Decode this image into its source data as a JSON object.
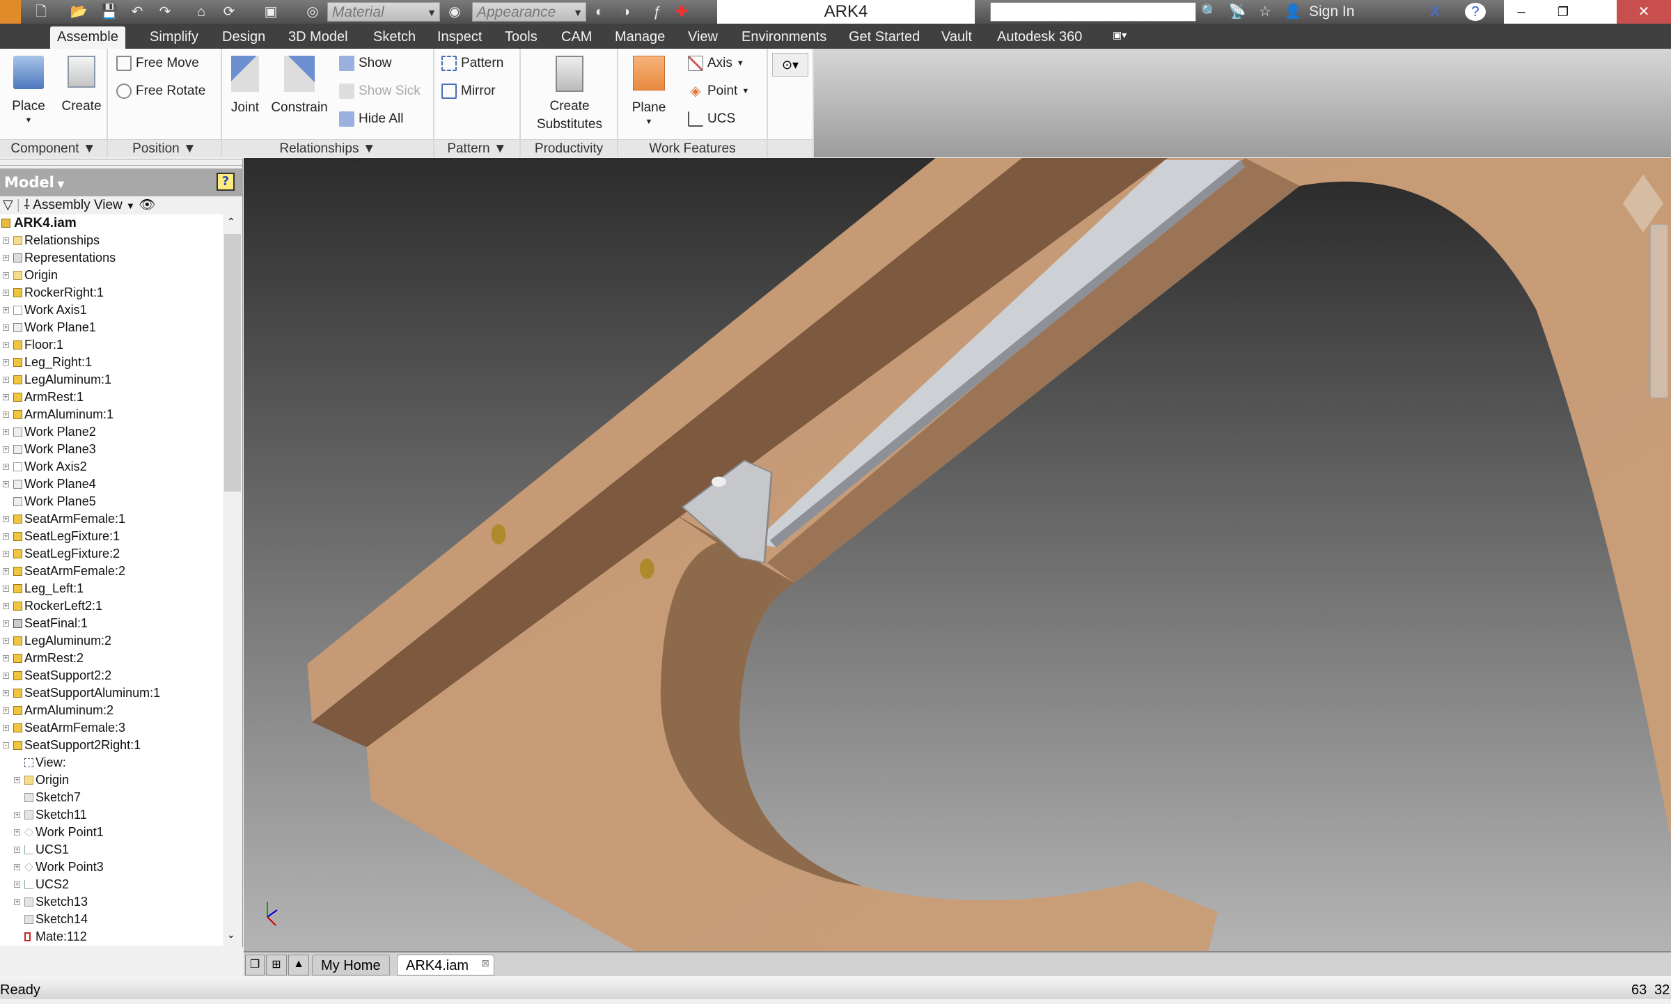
{
  "app": {
    "title": "ARK4",
    "sign_in": "Sign In"
  },
  "quick_access": {
    "material": "Material",
    "appearance": "Appearance",
    "search_value": ""
  },
  "tabs": [
    "Assemble",
    "Simplify",
    "Design",
    "3D Model",
    "Sketch",
    "Inspect",
    "Tools",
    "CAM",
    "Manage",
    "View",
    "Environments",
    "Get Started",
    "Vault",
    "Autodesk 360"
  ],
  "active_tab": "Assemble",
  "ribbon": {
    "component": {
      "label": "Component",
      "place": "Place",
      "create": "Create"
    },
    "position": {
      "label": "Position",
      "free_move": "Free Move",
      "free_rotate": "Free Rotate"
    },
    "relationships": {
      "label": "Relationships",
      "joint": "Joint",
      "constrain": "Constrain",
      "show": "Show",
      "show_sick": "Show Sick",
      "hide_all": "Hide All"
    },
    "pattern": {
      "label": "Pattern",
      "pattern": "Pattern",
      "mirror": "Mirror"
    },
    "productivity": {
      "label": "Productivity",
      "create_substitutes_1": "Create",
      "create_substitutes_2": "Substitutes"
    },
    "work_features": {
      "label": "Work Features",
      "plane": "Plane",
      "axis": "Axis",
      "point": "Point",
      "ucs": "UCS"
    }
  },
  "browser": {
    "title": "Model",
    "view": "Assembly View",
    "root": "ARK4.iam",
    "items": [
      {
        "label": "Relationships",
        "level": 0,
        "exp": "+",
        "icon": "folder"
      },
      {
        "label": "Representations",
        "level": 0,
        "exp": "+",
        "icon": "representations"
      },
      {
        "label": "Origin",
        "level": 0,
        "exp": "+",
        "icon": "folder"
      },
      {
        "label": "RockerRight:1",
        "level": 0,
        "exp": "+",
        "icon": "part"
      },
      {
        "label": "Work Axis1",
        "level": 0,
        "exp": "+",
        "icon": "work-axis"
      },
      {
        "label": "Work Plane1",
        "level": 0,
        "exp": "+",
        "icon": "work-plane"
      },
      {
        "label": "Floor:1",
        "level": 0,
        "exp": "+",
        "icon": "part"
      },
      {
        "label": "Leg_Right:1",
        "level": 0,
        "exp": "+",
        "icon": "part"
      },
      {
        "label": "LegAluminum:1",
        "level": 0,
        "exp": "+",
        "icon": "part"
      },
      {
        "label": "ArmRest:1",
        "level": 0,
        "exp": "+",
        "icon": "part"
      },
      {
        "label": "ArmAluminum:1",
        "level": 0,
        "exp": "+",
        "icon": "part"
      },
      {
        "label": "Work Plane2",
        "level": 0,
        "exp": "+",
        "icon": "work-plane"
      },
      {
        "label": "Work Plane3",
        "level": 0,
        "exp": "+",
        "icon": "work-plane"
      },
      {
        "label": "Work Axis2",
        "level": 0,
        "exp": "+",
        "icon": "work-axis"
      },
      {
        "label": "Work Plane4",
        "level": 0,
        "exp": "+",
        "icon": "work-plane"
      },
      {
        "label": "Work Plane5",
        "level": 0,
        "exp": "",
        "icon": "work-plane"
      },
      {
        "label": "SeatArmFemale:1",
        "level": 0,
        "exp": "+",
        "icon": "part"
      },
      {
        "label": "SeatLegFixture:1",
        "level": 0,
        "exp": "+",
        "icon": "part"
      },
      {
        "label": "SeatLegFixture:2",
        "level": 0,
        "exp": "+",
        "icon": "part"
      },
      {
        "label": "SeatArmFemale:2",
        "level": 0,
        "exp": "+",
        "icon": "part"
      },
      {
        "label": "Leg_Left:1",
        "level": 0,
        "exp": "+",
        "icon": "part"
      },
      {
        "label": "RockerLeft2:1",
        "level": 0,
        "exp": "+",
        "icon": "part"
      },
      {
        "label": "SeatFinal:1",
        "level": 0,
        "exp": "+",
        "icon": "assembly"
      },
      {
        "label": "LegAluminum:2",
        "level": 0,
        "exp": "+",
        "icon": "part"
      },
      {
        "label": "ArmRest:2",
        "level": 0,
        "exp": "+",
        "icon": "part"
      },
      {
        "label": "SeatSupport2:2",
        "level": 0,
        "exp": "+",
        "icon": "part"
      },
      {
        "label": "SeatSupportAluminum:1",
        "level": 0,
        "exp": "+",
        "icon": "part"
      },
      {
        "label": "ArmAluminum:2",
        "level": 0,
        "exp": "+",
        "icon": "part"
      },
      {
        "label": "SeatArmFemale:3",
        "level": 0,
        "exp": "+",
        "icon": "part"
      },
      {
        "label": "SeatSupport2Right:1",
        "level": 0,
        "exp": "-",
        "icon": "part"
      },
      {
        "label": "View:",
        "level": 1,
        "exp": "",
        "icon": "view"
      },
      {
        "label": "Origin",
        "level": 1,
        "exp": "+",
        "icon": "folder"
      },
      {
        "label": "Sketch7",
        "level": 1,
        "exp": "",
        "icon": "sketch"
      },
      {
        "label": "Sketch11",
        "level": 1,
        "exp": "+",
        "icon": "sketch"
      },
      {
        "label": "Work Point1",
        "level": 1,
        "exp": "+",
        "icon": "work-point"
      },
      {
        "label": "UCS1",
        "level": 1,
        "exp": "+",
        "icon": "ucs"
      },
      {
        "label": "Work Point3",
        "level": 1,
        "exp": "+",
        "icon": "work-point"
      },
      {
        "label": "UCS2",
        "level": 1,
        "exp": "+",
        "icon": "ucs"
      },
      {
        "label": "Sketch13",
        "level": 1,
        "exp": "+",
        "icon": "sketch"
      },
      {
        "label": "Sketch14",
        "level": 1,
        "exp": "",
        "icon": "sketch"
      },
      {
        "label": "Mate:112",
        "level": 1,
        "exp": "",
        "icon": "mate"
      }
    ]
  },
  "doc_tabs": [
    "My Home",
    "ARK4.iam"
  ],
  "status": {
    "text": "Ready",
    "num1": "63",
    "num2": "32"
  },
  "colors": {
    "wood": "#c79b73",
    "wood_dark": "#7d5a3f",
    "aluminum": "#cdd0d4",
    "close": "#c94f4f"
  }
}
